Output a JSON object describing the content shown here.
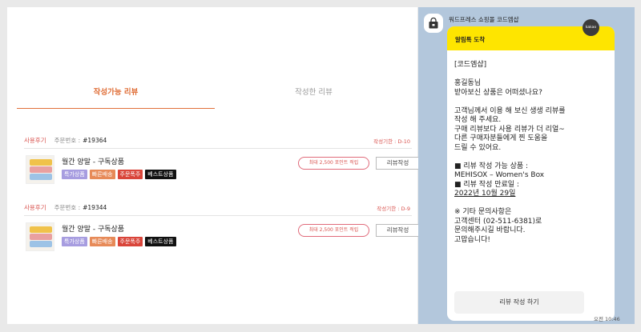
{
  "tabs": [
    {
      "label": "작성가능 리뷰",
      "active": true
    },
    {
      "label": "작성한 리뷰",
      "active": false
    }
  ],
  "orders": [
    {
      "used_tag": "사용후기",
      "order_no_label": "주문번호 :",
      "order_no": "#19364",
      "deadline": "작성기한 : D-10",
      "product": "월간 양말 - 구독상품",
      "badges": [
        "특가상품",
        "빠른배송",
        "주문폭주",
        "베스트상품"
      ],
      "point_button": "최대 2,500 포인트 적립",
      "review_button": "리뷰작성"
    },
    {
      "used_tag": "사용후기",
      "order_no_label": "주문번호 :",
      "order_no": "#19344",
      "deadline": "작성기한 : D-9",
      "product": "월간 양말 - 구독상품",
      "badges": [
        "특가상품",
        "빠른배송",
        "주문폭주",
        "베스트상품"
      ],
      "point_button": "최대 2,500 포인트 적립",
      "review_button": "리뷰작성"
    }
  ],
  "chat": {
    "sender": "워드프레스 쇼핑몰 코드엠샵",
    "header": "알림톡 도착",
    "badge": "kakao",
    "lines": [
      "[코드엠샵]",
      "",
      "홍길동님",
      "받아보신 상품은 어떠셨나요?",
      "",
      "고객님께서 이용 해 보신 생생 리뷰를",
      "작성 해 주세요.",
      "구매 리뷰보다 사용 리뷰가 더 리얼~",
      "다른 구매자분들에게 찐 도움을",
      "드릴 수 있어요.",
      "",
      "■ 리뷰 작성 가능 상품 :",
      "MEHISOX – Women's Box",
      "■ 리뷰 작성 만료일 :",
      "2022년 10월 29일",
      "",
      "※ 기타 문의사항은",
      "고객센터 (02-511-6381)로",
      "문의해주시길 바랍니다.",
      "고맙습니다!"
    ],
    "button": "리뷰 작성 하기",
    "time": "오전 10:46"
  },
  "colors": {
    "accent": "#e0703a",
    "kakao_yellow": "#fee500",
    "chat_bg": "#b3c7dc"
  }
}
